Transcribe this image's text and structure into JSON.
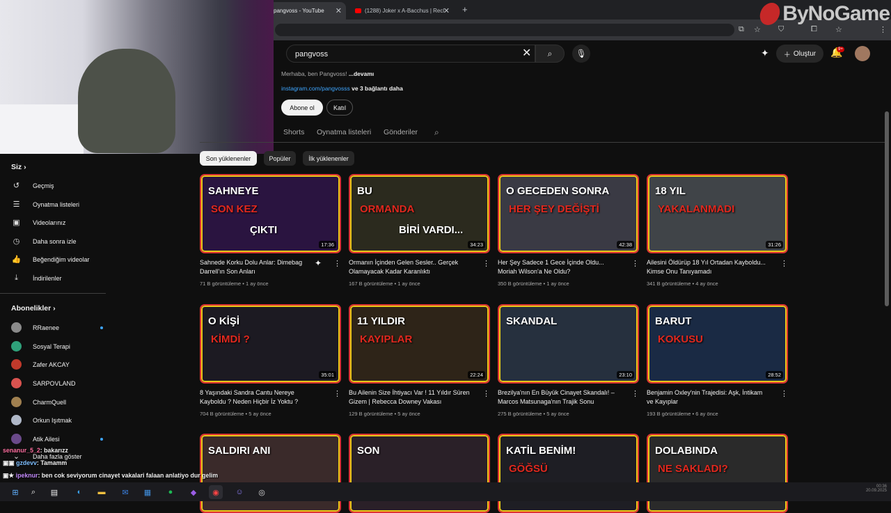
{
  "browser": {
    "tabs": [
      {
        "label": "pangvoss - YouTube",
        "close": "✕"
      },
      {
        "label": "(1288) Joker x A-Bacchus | Recl",
        "close": "✕"
      }
    ],
    "new_tab": "+"
  },
  "watermark": "ByNoGame",
  "header": {
    "search_value": "pangvoss",
    "create_label": "Oluştur",
    "notification_badge": "9+"
  },
  "channel": {
    "description": "Merhaba, ben Pangvoss!",
    "more": "...devamı",
    "link": "instagram.com/pangvosss",
    "link_more": "ve 3 bağlantı daha",
    "subscribe": "Abone ol",
    "join": "Katıl"
  },
  "channel_tabs": [
    "Shorts",
    "Oynatma listeleri",
    "Gönderiler"
  ],
  "chips": [
    "Son yüklenenler",
    "Popüler",
    "İlk yüklenenler"
  ],
  "sidebar": {
    "you_header": "Siz",
    "you_items": [
      {
        "label": "Geçmiş",
        "icon": "history-icon"
      },
      {
        "label": "Oynatma listeleri",
        "icon": "playlist-icon"
      },
      {
        "label": "Videolarınız",
        "icon": "your-videos-icon"
      },
      {
        "label": "Daha sonra izle",
        "icon": "watch-later-icon"
      },
      {
        "label": "Beğendiğim videolar",
        "icon": "like-icon"
      },
      {
        "label": "İndirilenler",
        "icon": "download-icon"
      }
    ],
    "subs_header": "Abonelikler",
    "subs": [
      {
        "label": "RRaenee",
        "color": "#8a8a8a",
        "new": true
      },
      {
        "label": "Sosyal Terapi",
        "color": "#2fa07a",
        "new": false
      },
      {
        "label": "Zafer AKCAY",
        "color": "#c0392b",
        "new": false
      },
      {
        "label": "SARPOVLAND",
        "color": "#d9534f",
        "new": false
      },
      {
        "label": "CharmQuell",
        "color": "#a08050",
        "new": false
      },
      {
        "label": "Orkun Işıtmak",
        "color": "#b0b8c8",
        "new": false
      },
      {
        "label": "Atik Ailesi",
        "color": "#6a4a8a",
        "new": true
      }
    ],
    "show_more": "Daha fazla göster"
  },
  "videos": [
    {
      "title": "Sahnede Korku Dolu Anlar: Dimebag Darrell'ın Son Anları",
      "views": "71 B görüntüleme",
      "age": "1 ay önce",
      "duration": "17:36",
      "thumb_text": "SAHNEYE",
      "thumb_text2": "SON KEZ",
      "thumb_text3": "ÇIKTI",
      "bg": "#2a1440"
    },
    {
      "title": "Ormanın İçinden Gelen Sesler.. Gerçek Olamayacak Kadar Karanlıktı",
      "views": "167 B görüntüleme",
      "age": "1 ay önce",
      "duration": "34:23",
      "thumb_text": "BU",
      "thumb_text2": "ORMANDA",
      "thumb_text3": "BİRİ VARDI...",
      "bg": "#2b2a1e"
    },
    {
      "title": "Her Şey Sadece 1 Gece İçinde Oldu... Moriah Wilson'a Ne Oldu?",
      "views": "350 B görüntüleme",
      "age": "1 ay önce",
      "duration": "42:38",
      "thumb_text": "O GECEDEN SONRA",
      "thumb_text2": "HER ŞEY DEĞİŞTİ",
      "thumb_text3": "",
      "bg": "#3a3a44"
    },
    {
      "title": "Ailesini Öldürüp 18 Yıl Ortadan Kayboldu... Kimse Onu Tanıyamadı",
      "views": "341 B görüntüleme",
      "age": "4 ay önce",
      "duration": "31:26",
      "thumb_text": "18 YIL",
      "thumb_text2": "YAKALANMADI",
      "thumb_text3": "",
      "bg": "#404448"
    },
    {
      "title": "8 Yaşındaki Sandra Cantu Nereye Kayboldu ? Neden Hiçbir İz Yoktu ?",
      "views": "704 B görüntüleme",
      "age": "5 ay önce",
      "duration": "35:01",
      "thumb_text": "O KİŞİ",
      "thumb_text2": "KİMDİ ?",
      "thumb_text3": "",
      "bg": "#1c1a22"
    },
    {
      "title": "Bu Ailenin Size İhtiyacı Var ! 11 Yıldır Süren Gizem | Rebecca Downey Vakası",
      "views": "129 B görüntüleme",
      "age": "5 ay önce",
      "duration": "22:24",
      "thumb_text": "11 YILDIR",
      "thumb_text2": "KAYIPLAR",
      "thumb_text3": "",
      "bg": "#2e2418"
    },
    {
      "title": "Brezilya'nın En Büyük Cinayet Skandalı! – Marcos Matsunaga'nın Trajik Sonu",
      "views": "275 B görüntüleme",
      "age": "5 ay önce",
      "duration": "23:10",
      "thumb_text": "SKANDAL",
      "thumb_text2": "",
      "thumb_text3": "",
      "bg": "#26303e"
    },
    {
      "title": "Benjamin Oxley'nin Trajedisi: Aşk, İntikam ve Kayıplar",
      "views": "193 B görüntüleme",
      "age": "6 ay önce",
      "duration": "28:52",
      "thumb_text": "BARUT",
      "thumb_text2": "KOKUSU",
      "thumb_text3": "",
      "bg": "#1a2a44"
    },
    {
      "title": "",
      "views": "",
      "age": "",
      "duration": "",
      "thumb_text": "SALDIRI ANI",
      "thumb_text2": "",
      "thumb_text3": "",
      "bg": "#3a2a2a"
    },
    {
      "title": "",
      "views": "",
      "age": "",
      "duration": "",
      "thumb_text": "SON",
      "thumb_text2": "",
      "thumb_text3": "",
      "bg": "#2a2028"
    },
    {
      "title": "",
      "views": "",
      "age": "",
      "duration": "",
      "thumb_text": "KATİL BENİM!",
      "thumb_text2": "GÖĞSÜ",
      "thumb_text3": "",
      "bg": "#1e1e24"
    },
    {
      "title": "",
      "views": "",
      "age": "",
      "duration": "",
      "thumb_text": "DOLABINDA",
      "thumb_text2": "NE SAKLADI?",
      "thumb_text3": "",
      "bg": "#2a2a2a"
    }
  ],
  "chat": [
    {
      "user": "senanur_5_2",
      "text": ": bakarızz"
    },
    {
      "user": "gzdevv",
      "text": ": Tamamm"
    },
    {
      "user": "ipeknur",
      "text": ": ben cok seviyorum cinayet vakalari falaan anlatiyo dur gelim"
    }
  ],
  "taskbar": {
    "time": "00:36",
    "date": "20.09.2025"
  }
}
